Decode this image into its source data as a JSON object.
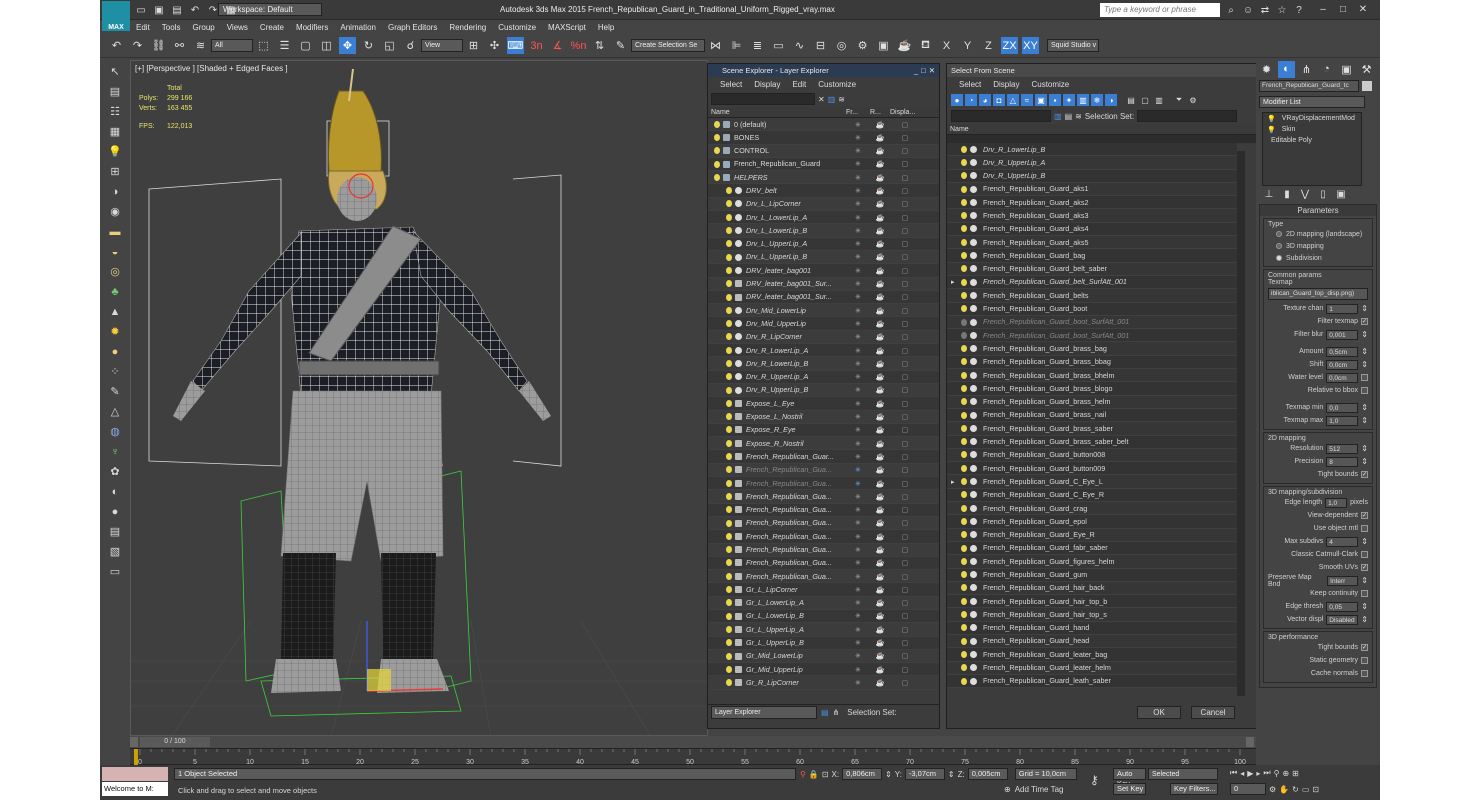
{
  "app": {
    "title": "Autodesk 3ds Max  2015    French_Republican_Guard_in_Traditional_Uniform_Rigged_vray.max",
    "logo_text": "MAX",
    "workspace": "Workspace: Default",
    "search_placeholder": "Type a keyword or phrase"
  },
  "menu": [
    "Edit",
    "Tools",
    "Group",
    "Views",
    "Create",
    "Modifiers",
    "Animation",
    "Graph Editors",
    "Rendering",
    "Customize",
    "MAXScript",
    "Help"
  ],
  "toolbar": {
    "filter": "All",
    "ref_coord": "View",
    "create_selection_set": "Create Selection Se",
    "axes": [
      "X",
      "Y",
      "Z",
      "ZX",
      "XY"
    ],
    "workspace_label": "Squid Studio v",
    "snap_labels": [
      "3n",
      "%n"
    ]
  },
  "viewport": {
    "label": "[+] [Perspective ] [Shaded + Edged Faces ]",
    "stats": {
      "total_label": "Total",
      "polys_label": "Polys:",
      "polys": "299 166",
      "verts_label": "Verts:",
      "verts": "163 455",
      "fps_label": "FPS:",
      "fps": "122,013"
    }
  },
  "scene_explorer": {
    "title": "Scene Explorer - Layer Explorer",
    "menu": [
      "Select",
      "Display",
      "Edit",
      "Customize"
    ],
    "columns": [
      "Name",
      "Fr...",
      "R...",
      "Displa..."
    ],
    "rows": [
      {
        "name": "0 (default)",
        "indent": 1,
        "italic": false,
        "icon": "layer"
      },
      {
        "name": "BONES",
        "indent": 1,
        "italic": false,
        "icon": "layer"
      },
      {
        "name": "CONTROL",
        "indent": 1,
        "italic": false,
        "icon": "layer"
      },
      {
        "name": "French_Republican_Guard",
        "indent": 1,
        "italic": false,
        "icon": "layer"
      },
      {
        "name": "HELPERS",
        "indent": 1,
        "italic": true,
        "icon": "layer"
      },
      {
        "name": "DRV_belt",
        "indent": 2,
        "italic": true,
        "icon": "dot"
      },
      {
        "name": "Drv_L_LipCorner",
        "indent": 2,
        "italic": true,
        "icon": "dot"
      },
      {
        "name": "Drv_L_LowerLip_A",
        "indent": 2,
        "italic": true,
        "icon": "dot"
      },
      {
        "name": "Drv_L_LowerLip_B",
        "indent": 2,
        "italic": true,
        "icon": "dot"
      },
      {
        "name": "Drv_L_UpperLip_A",
        "indent": 2,
        "italic": true,
        "icon": "dot"
      },
      {
        "name": "Drv_L_UpperLip_B",
        "indent": 2,
        "italic": true,
        "icon": "dot"
      },
      {
        "name": "DRV_leater_bag001",
        "indent": 2,
        "italic": true,
        "icon": "dot"
      },
      {
        "name": "DRV_leater_bag001_Sur...",
        "indent": 2,
        "italic": true,
        "icon": "group"
      },
      {
        "name": "DRV_leater_bag001_Sur...",
        "indent": 2,
        "italic": true,
        "icon": "group"
      },
      {
        "name": "Drv_Mid_LowerLip",
        "indent": 2,
        "italic": true,
        "icon": "dot"
      },
      {
        "name": "Drv_Mid_UpperLip",
        "indent": 2,
        "italic": true,
        "icon": "dot"
      },
      {
        "name": "Drv_R_LipCorner",
        "indent": 2,
        "italic": true,
        "icon": "dot"
      },
      {
        "name": "Drv_R_LowerLip_A",
        "indent": 2,
        "italic": true,
        "icon": "dot"
      },
      {
        "name": "Drv_R_LowerLip_B",
        "indent": 2,
        "italic": true,
        "icon": "dot"
      },
      {
        "name": "Drv_R_UpperLip_A",
        "indent": 2,
        "italic": true,
        "icon": "dot"
      },
      {
        "name": "Drv_R_UpperLip_B",
        "indent": 2,
        "italic": true,
        "icon": "dot"
      },
      {
        "name": "Expose_L_Eye",
        "indent": 2,
        "italic": true,
        "icon": "group"
      },
      {
        "name": "Expose_L_Nostril",
        "indent": 2,
        "italic": true,
        "icon": "group"
      },
      {
        "name": "Expose_R_Eye",
        "indent": 2,
        "italic": true,
        "icon": "group"
      },
      {
        "name": "Expose_R_Nostril",
        "indent": 2,
        "italic": true,
        "icon": "group"
      },
      {
        "name": "French_Republican_Guar...",
        "indent": 2,
        "italic": true,
        "icon": "group"
      },
      {
        "name": "French_Republican_Gua...",
        "indent": 2,
        "italic": true,
        "icon": "group",
        "dim": true
      },
      {
        "name": "French_Republican_Gua...",
        "indent": 2,
        "italic": true,
        "icon": "group",
        "dim": true
      },
      {
        "name": "French_Republican_Gua...",
        "indent": 2,
        "italic": true,
        "icon": "group"
      },
      {
        "name": "French_Republican_Gua...",
        "indent": 2,
        "italic": true,
        "icon": "group"
      },
      {
        "name": "French_Republican_Gua...",
        "indent": 2,
        "italic": true,
        "icon": "group"
      },
      {
        "name": "French_Republican_Gua...",
        "indent": 2,
        "italic": true,
        "icon": "group"
      },
      {
        "name": "French_Republican_Gua...",
        "indent": 2,
        "italic": true,
        "icon": "group"
      },
      {
        "name": "French_Republican_Gua...",
        "indent": 2,
        "italic": true,
        "icon": "group"
      },
      {
        "name": "French_Republican_Gua...",
        "indent": 2,
        "italic": true,
        "icon": "group"
      },
      {
        "name": "Gr_L_LipCorner",
        "indent": 2,
        "italic": true,
        "icon": "group"
      },
      {
        "name": "Gr_L_LowerLip_A",
        "indent": 2,
        "italic": true,
        "icon": "group"
      },
      {
        "name": "Gr_L_LowerLip_B",
        "indent": 2,
        "italic": true,
        "icon": "group"
      },
      {
        "name": "Gr_L_UpperLip_A",
        "indent": 2,
        "italic": true,
        "icon": "group"
      },
      {
        "name": "Gr_L_UpperLip_B",
        "indent": 2,
        "italic": true,
        "icon": "group"
      },
      {
        "name": "Gr_Mid_LowerLip",
        "indent": 2,
        "italic": true,
        "icon": "group"
      },
      {
        "name": "Gr_Mid_UpperLip",
        "indent": 2,
        "italic": true,
        "icon": "group"
      },
      {
        "name": "Gr_R_LipCorner",
        "indent": 2,
        "italic": true,
        "icon": "group"
      }
    ],
    "footer_select": "Layer Explorer",
    "footer_selection_set": "Selection Set:"
  },
  "select_from_scene": {
    "title": "Select From Scene",
    "menu": [
      "Select",
      "Display",
      "Customize"
    ],
    "selection_set_label": "Selection Set:",
    "column": "Name",
    "rows": [
      {
        "name": "Drv_R_LowerLip_B",
        "italic": true
      },
      {
        "name": "Drv_R_UpperLip_A",
        "italic": true
      },
      {
        "name": "Drv_R_UpperLip_B",
        "italic": true
      },
      {
        "name": "French_Republican_Guard_aks1"
      },
      {
        "name": "French_Republican_Guard_aks2"
      },
      {
        "name": "French_Republican_Guard_aks3"
      },
      {
        "name": "French_Republican_Guard_aks4"
      },
      {
        "name": "French_Republican_Guard_aks5"
      },
      {
        "name": "French_Republican_Guard_bag"
      },
      {
        "name": "French_Republican_Guard_belt_saber"
      },
      {
        "name": "French_Republican_Guard_belt_SurfAtt_001",
        "italic": true,
        "expand": true
      },
      {
        "name": "French_Republican_Guard_belts"
      },
      {
        "name": "French_Republican_Guard_boot"
      },
      {
        "name": "French_Republican_Guard_boot_SurfAtt_001",
        "italic": true,
        "dim": true
      },
      {
        "name": "French_Republican_Guard_boot_SurfAtt_001",
        "italic": true,
        "dim": true
      },
      {
        "name": "French_Republican_Guard_brass_bag"
      },
      {
        "name": "French_Republican_Guard_brass_bbag"
      },
      {
        "name": "French_Republican_Guard_brass_bhelm"
      },
      {
        "name": "French_Republican_Guard_brass_blogo"
      },
      {
        "name": "French_Republican_Guard_brass_helm"
      },
      {
        "name": "French_Republican_Guard_brass_nail"
      },
      {
        "name": "French_Republican_Guard_brass_saber"
      },
      {
        "name": "French_Republican_Guard_brass_saber_belt"
      },
      {
        "name": "French_Republican_Guard_button008"
      },
      {
        "name": "French_Republican_Guard_button009"
      },
      {
        "name": "French_Republican_Guard_C_Eye_L",
        "expand": true
      },
      {
        "name": "French_Republican_Guard_C_Eye_R"
      },
      {
        "name": "French_Republican_Guard_crag"
      },
      {
        "name": "French_Republican_Guard_epol"
      },
      {
        "name": "French_Republican_Guard_Eye_R"
      },
      {
        "name": "French_Republican_Guard_fabr_saber"
      },
      {
        "name": "French_Republican_Guard_figures_helm"
      },
      {
        "name": "French_Republican_Guard_gum"
      },
      {
        "name": "French_Republican_Guard_hair_back"
      },
      {
        "name": "French_Republican_Guard_hair_top_b"
      },
      {
        "name": "French_Republican_Guard_hair_top_s"
      },
      {
        "name": "French_Republican_Guard_hand"
      },
      {
        "name": "French_Republican_Guard_head"
      },
      {
        "name": "French_Republican_Guard_leater_bag"
      },
      {
        "name": "French_Republican_Guard_leater_helm"
      },
      {
        "name": "French_Republican_Guard_leath_saber"
      }
    ],
    "ok": "OK",
    "cancel": "Cancel"
  },
  "command_panel": {
    "object_name": "French_Republican_Guard_tc",
    "modifier_list": "Modifier List",
    "stack": [
      "VRayDisplacementMod",
      "Skin",
      "Editable Poly"
    ],
    "parameters_title": "Parameters",
    "type_label": "Type",
    "type_options": [
      {
        "label": "2D mapping (landscape)",
        "selected": false
      },
      {
        "label": "3D mapping",
        "selected": false
      },
      {
        "label": "Subdivision",
        "selected": true
      }
    ],
    "common_params": "Common params",
    "texmap_label": "Texmap",
    "texmap_value": "iblican_Guard_top_disp.png)",
    "params_a": [
      {
        "label": "Texture chan",
        "value": "1"
      },
      {
        "label": "Filter texmap",
        "check": true
      },
      {
        "label": "Filter blur",
        "value": "0,001"
      }
    ],
    "params_b": [
      {
        "label": "Amount",
        "value": "0,5cm"
      },
      {
        "label": "Shift",
        "value": "0,0cm"
      },
      {
        "label": "Water level",
        "value": "0,0cm",
        "check": false
      },
      {
        "label": "Relative to bbox",
        "check": false
      }
    ],
    "params_c": [
      {
        "label": "Texmap min",
        "value": "0,0"
      },
      {
        "label": "Texmap max",
        "value": "1,0"
      }
    ],
    "mapping_2d": "2D mapping",
    "params_2d": [
      {
        "label": "Resolution",
        "value": "512"
      },
      {
        "label": "Precision",
        "value": "8"
      },
      {
        "label": "Tight bounds",
        "check": true
      }
    ],
    "mapping_3d": "3D mapping/subdivision",
    "edge_length_label": "Edge length",
    "edge_length_value": "1,0",
    "pixels": "pixels",
    "params_3d": [
      {
        "label": "View-dependent",
        "check": true
      },
      {
        "label": "Use object mtl",
        "check": false
      },
      {
        "label": "Max subdivs",
        "value": "4"
      },
      {
        "label": "Classic Catmull-Clark",
        "check": false
      },
      {
        "label": "Smooth UVs",
        "check": true
      },
      {
        "label": "Preserve Map Bnd",
        "value": "Interr"
      },
      {
        "label": "Keep continuity",
        "check": false
      },
      {
        "label": "Edge thresh",
        "value": "0,05"
      },
      {
        "label": "Vector displ",
        "value": "Disabled"
      }
    ],
    "perf_title": "3D performance",
    "params_perf": [
      {
        "label": "Tight bounds",
        "check": true
      },
      {
        "label": "Static geometry",
        "check": false
      },
      {
        "label": "Cache normals",
        "check": false
      }
    ]
  },
  "timeline": {
    "frame": "0 / 100",
    "ticks": [
      "0",
      "5",
      "10",
      "15",
      "20",
      "25",
      "30",
      "35",
      "40",
      "45",
      "50",
      "55",
      "60",
      "65",
      "70",
      "75",
      "80",
      "85",
      "90",
      "95",
      "100"
    ]
  },
  "status": {
    "welcome": "Welcome to M:",
    "selected": "1 Object Selected",
    "prompt": "Click and drag to select and move objects",
    "x_label": "X:",
    "x": "0,806cm",
    "y_label": "Y:",
    "y": "-3,07cm",
    "z_label": "Z:",
    "z": "0,005cm",
    "grid": "Grid = 10,0cm",
    "add_time_tag": "Add Time Tag",
    "auto_key": "Auto Key",
    "set_key": "Set Key",
    "selected_dropdown": "Selected",
    "key_filters": "Key Filters...",
    "current_frame": "0"
  }
}
